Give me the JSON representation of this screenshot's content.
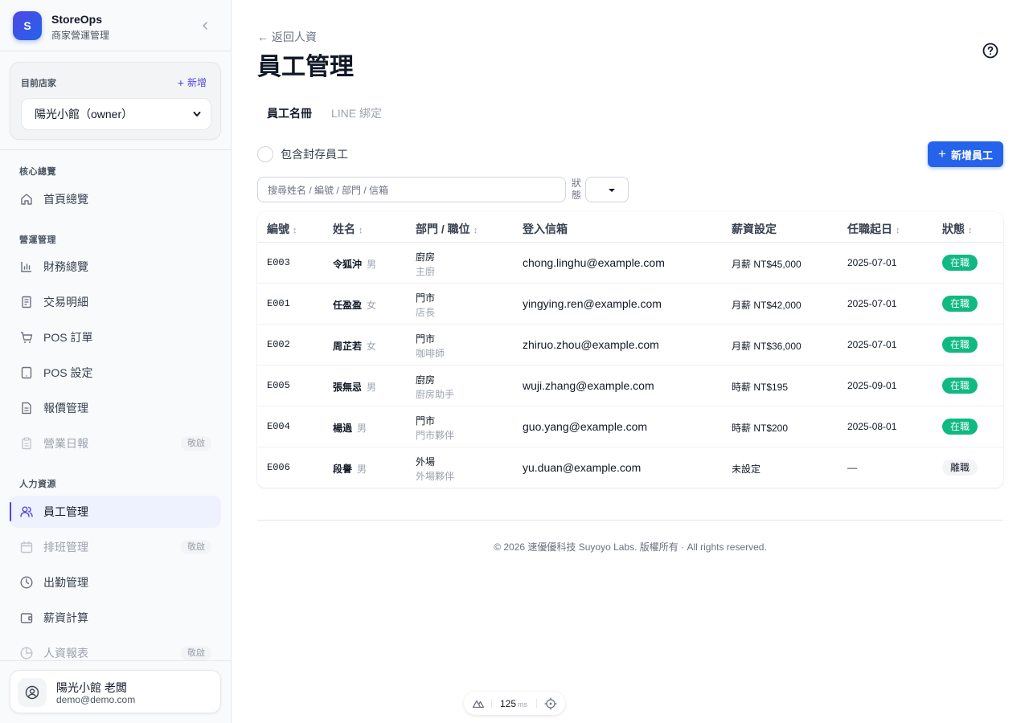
{
  "brand": {
    "logo_letter": "S",
    "name": "StoreOps",
    "subtitle": "商家營運管理"
  },
  "store": {
    "label": "目前店家",
    "add_label": "新增",
    "selected": "陽光小館（owner）"
  },
  "nav": {
    "sections": [
      {
        "title": "核心總覽"
      },
      {
        "title": "營運管理"
      },
      {
        "title": "人力資源"
      }
    ],
    "items": [
      {
        "label": "首頁總覽",
        "icon": "home-icon"
      },
      {
        "label": "財務總覽",
        "icon": "bar-chart-icon"
      },
      {
        "label": "交易明細",
        "icon": "receipt-icon"
      },
      {
        "label": "POS 訂單",
        "icon": "cart-icon"
      },
      {
        "label": "POS 設定",
        "icon": "tablet-icon"
      },
      {
        "label": "報價管理",
        "icon": "file-text-icon"
      },
      {
        "label": "營業日報",
        "icon": "clipboard-icon",
        "badge": "敬啟"
      },
      {
        "label": "員工管理",
        "icon": "users-icon"
      },
      {
        "label": "排班管理",
        "icon": "calendar-icon",
        "badge": "敬啟"
      },
      {
        "label": "出勤管理",
        "icon": "clock-icon"
      },
      {
        "label": "薪資計算",
        "icon": "wallet-icon"
      },
      {
        "label": "人資報表",
        "icon": "pie-chart-icon",
        "badge": "敬啟"
      }
    ]
  },
  "user": {
    "name": "陽光小館 老闆",
    "email": "demo@demo.com"
  },
  "page": {
    "back_label": "← 返回人資",
    "title": "員工管理",
    "tabs": [
      "員工名冊",
      "LINE 綁定"
    ],
    "archive_label": "包含封存員工",
    "add_button": "新增員工",
    "search_placeholder": "搜尋姓名 / 編號 / 部門 / 信箱",
    "status_filter_label": "狀態"
  },
  "table": {
    "headers": [
      "編號",
      "姓名",
      "部門 / 職位",
      "登入信箱",
      "薪資設定",
      "任職起日",
      "狀態"
    ],
    "sort_glyph": "↕",
    "rows": [
      {
        "id": "E003",
        "name": "令狐沖",
        "gender": "男",
        "dept": "廚房",
        "role": "主廚",
        "email": "chong.linghu@example.com",
        "salary": "月薪 NT$45,000",
        "start": "2025-07-01",
        "status": "在職"
      },
      {
        "id": "E001",
        "name": "任盈盈",
        "gender": "女",
        "dept": "門市",
        "role": "店長",
        "email": "yingying.ren@example.com",
        "salary": "月薪 NT$42,000",
        "start": "2025-07-01",
        "status": "在職"
      },
      {
        "id": "E002",
        "name": "周芷若",
        "gender": "女",
        "dept": "門市",
        "role": "咖啡師",
        "email": "zhiruo.zhou@example.com",
        "salary": "月薪 NT$36,000",
        "start": "2025-07-01",
        "status": "在職"
      },
      {
        "id": "E005",
        "name": "張無忌",
        "gender": "男",
        "dept": "廚房",
        "role": "廚房助手",
        "email": "wuji.zhang@example.com",
        "salary": "時薪 NT$195",
        "start": "2025-09-01",
        "status": "在職"
      },
      {
        "id": "E004",
        "name": "楊過",
        "gender": "男",
        "dept": "門市",
        "role": "門市夥伴",
        "email": "guo.yang@example.com",
        "salary": "時薪 NT$200",
        "start": "2025-08-01",
        "status": "在職"
      },
      {
        "id": "E006",
        "name": "段譽",
        "gender": "男",
        "dept": "外場",
        "role": "外場夥伴",
        "email": "yu.duan@example.com",
        "salary": "未設定",
        "start": "—",
        "status": "離職"
      }
    ]
  },
  "footer": {
    "text": "© 2026 速優優科技 Suyoyo Labs. 版權所有 · All rights reserved."
  },
  "devbar": {
    "timing": "125",
    "unit": "ms"
  },
  "colors": {
    "accent": "#4f46e5",
    "primary_button": "#2563eb",
    "status_active": "#10b981"
  }
}
